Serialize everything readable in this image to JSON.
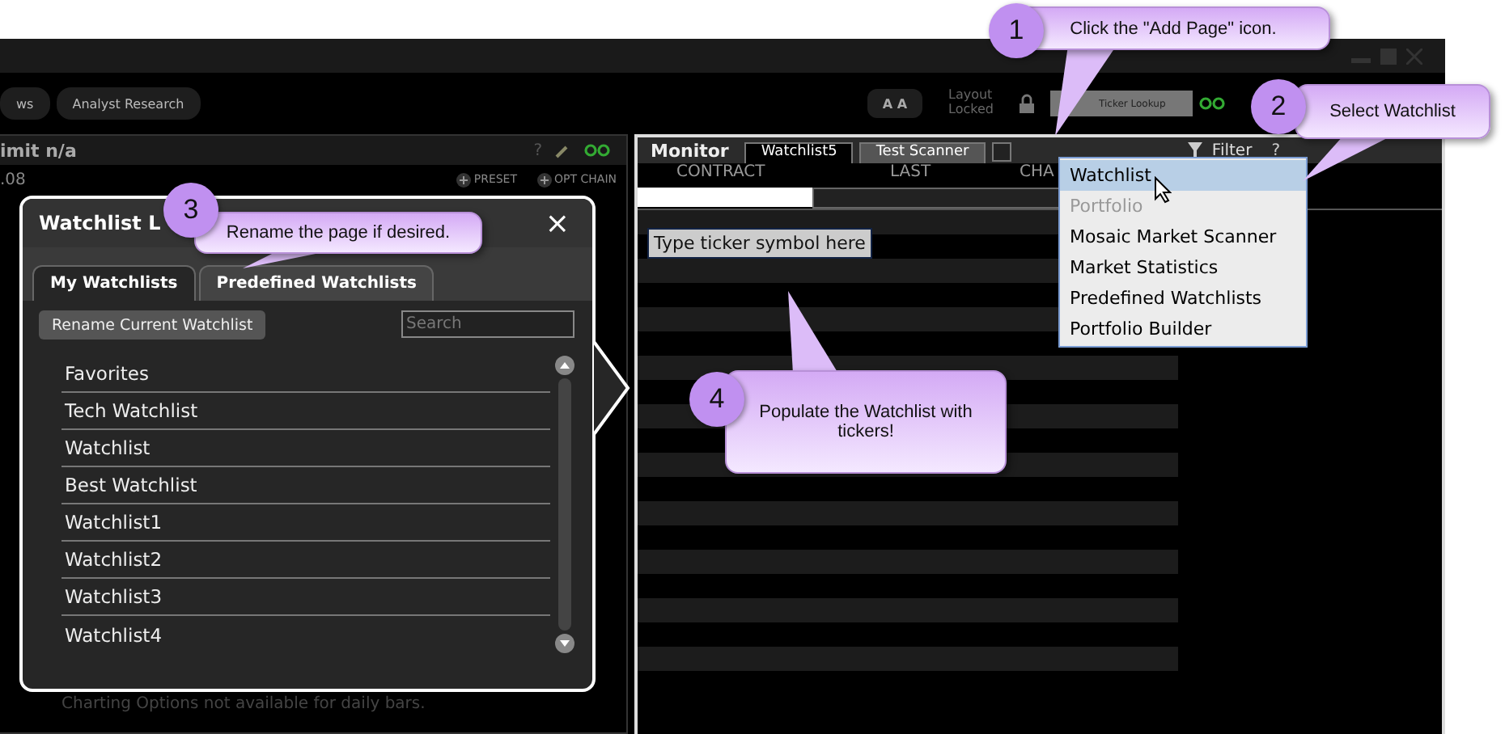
{
  "toolbar": {
    "tabs": [
      {
        "label": "ws",
        "selected": false
      },
      {
        "label": "Analyst Research",
        "selected": false
      }
    ],
    "font_button": "A A",
    "layout_status": "Layout Locked",
    "ticker_lookup": {
      "placeholder": "Ticker Lookup"
    }
  },
  "left_panel": {
    "title": "imit n/a",
    "help": "?",
    "value": ".08",
    "actions": [
      "PRESET",
      "OPT CHAIN"
    ],
    "note": "Charting Options not available for daily bars."
  },
  "monitor": {
    "title": "Monitor",
    "tabs": [
      {
        "label": "Watchlist5",
        "selected": true
      },
      {
        "label": "Test Scanner",
        "selected": false
      }
    ],
    "filter": "Filter",
    "help": "?",
    "columns": [
      "CONTRACT",
      "LAST",
      "CHA"
    ],
    "tooltip": "Type ticker symbol here"
  },
  "add_page_menu": {
    "items": [
      {
        "label": "Watchlist",
        "selected": true,
        "disabled": false
      },
      {
        "label": "Portfolio",
        "selected": false,
        "disabled": true
      },
      {
        "label": "Mosaic Market Scanner",
        "selected": false,
        "disabled": false
      },
      {
        "label": "Market Statistics",
        "selected": false,
        "disabled": false
      },
      {
        "label": "Predefined Watchlists",
        "selected": false,
        "disabled": false
      },
      {
        "label": "Portfolio Builder",
        "selected": false,
        "disabled": false
      }
    ]
  },
  "watchlist_dialog": {
    "title": "Watchlist L",
    "close": "×",
    "tabs": [
      {
        "label": "My Watchlists",
        "selected": true
      },
      {
        "label": "Predefined Watchlists",
        "selected": false
      }
    ],
    "rename_button": "Rename Current Watchlist",
    "search": {
      "placeholder": "Search"
    },
    "items": [
      "Favorites",
      "Tech Watchlist",
      "Watchlist",
      "Best Watchlist",
      "Watchlist1",
      "Watchlist2",
      "Watchlist3",
      "Watchlist4"
    ]
  },
  "callouts": [
    {
      "number": "1",
      "text": "Click the \"Add Page\" icon."
    },
    {
      "number": "2",
      "text": "Select Watchlist"
    },
    {
      "number": "3",
      "text": "Rename the page if desired."
    },
    {
      "number": "4",
      "text": "Populate the Watchlist with tickers!"
    }
  ]
}
